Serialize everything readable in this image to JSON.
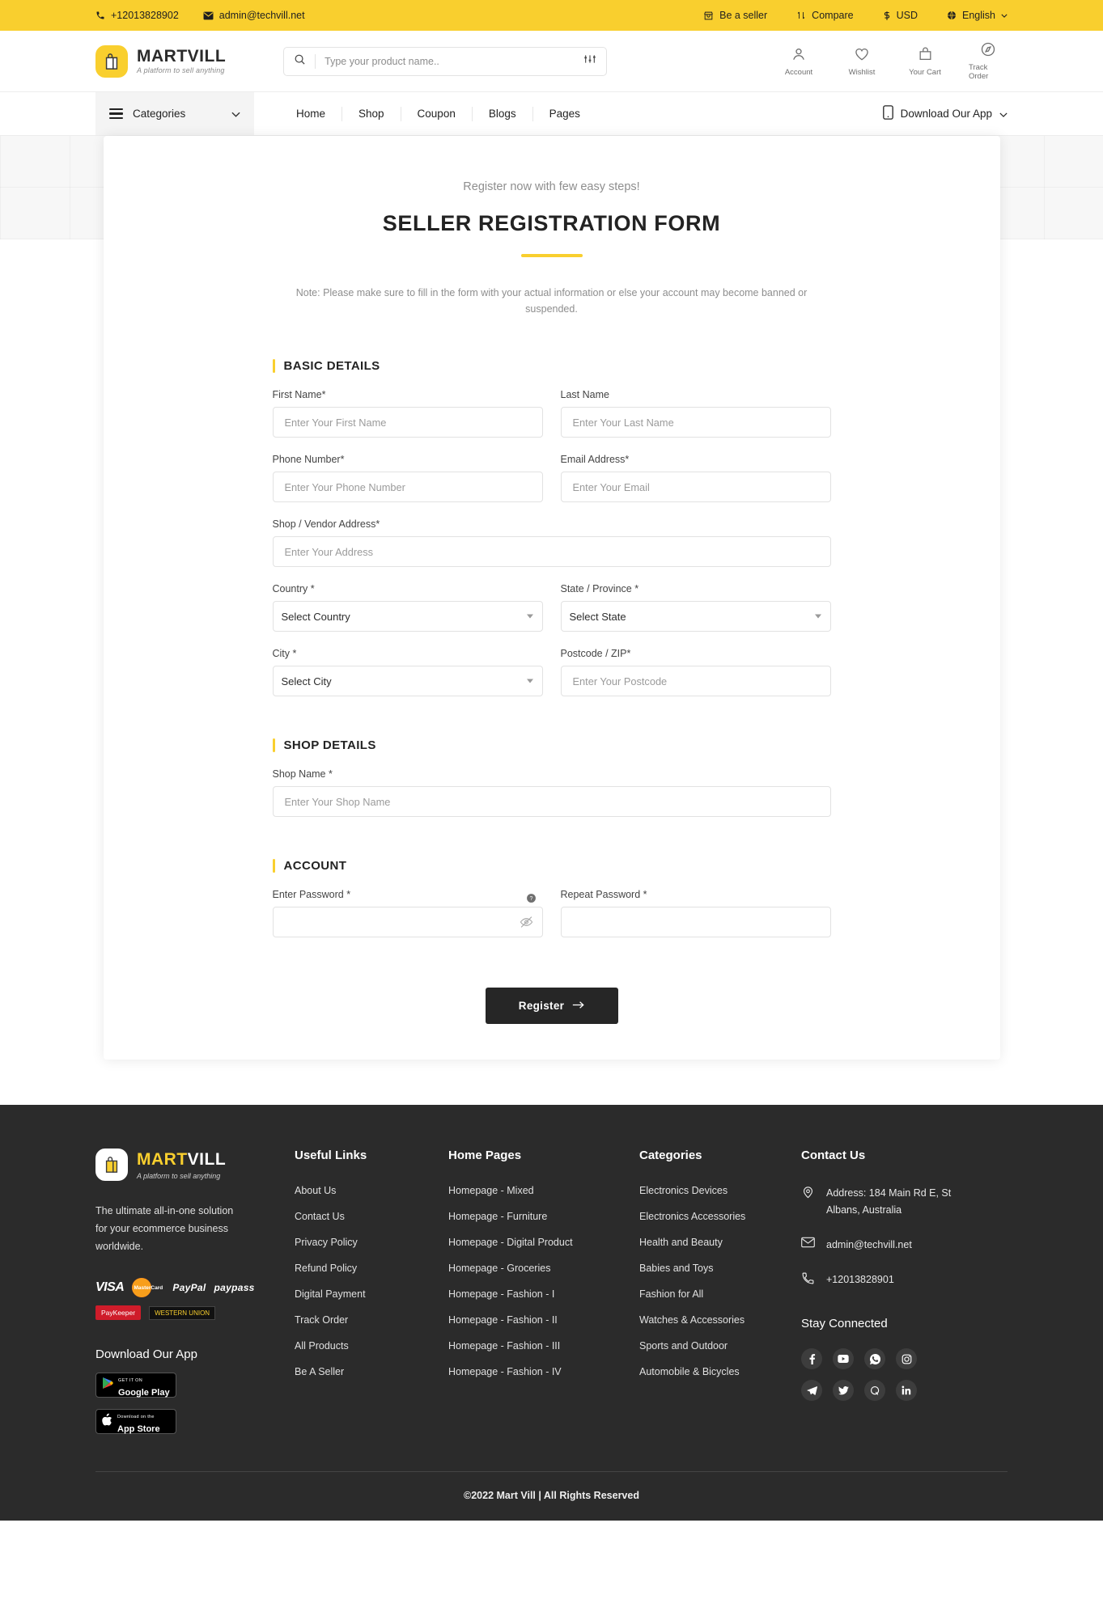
{
  "topbar": {
    "phone": "+12013828902",
    "email": "admin@techvill.net",
    "be_a_seller": "Be a seller",
    "compare": "Compare",
    "currency": "USD",
    "language": "English"
  },
  "brand": {
    "name_mart": "MART",
    "name_vill": "VILL",
    "name_full": "MARTVILL",
    "tagline": "A platform to sell anything"
  },
  "search": {
    "placeholder": "Type your product name.."
  },
  "header_actions": [
    {
      "label": "Account"
    },
    {
      "label": "Wishlist"
    },
    {
      "label": "Your Cart"
    },
    {
      "label": "Track Order"
    }
  ],
  "nav": {
    "categories": "Categories",
    "items": [
      {
        "label": "Home"
      },
      {
        "label": "Shop"
      },
      {
        "label": "Coupon"
      },
      {
        "label": "Blogs"
      },
      {
        "label": "Pages"
      }
    ],
    "download_app": "Download Our App"
  },
  "form": {
    "kicker": "Register now with few easy steps!",
    "title": "SELLER REGISTRATION FORM",
    "note": "Note: Please make sure to fill in the form with your actual information or else your account may become banned or suspended.",
    "section_basic": "BASIC DETAILS",
    "section_shop": "SHOP DETAILS",
    "section_account": "ACCOUNT",
    "first_name": {
      "label": "First Name*",
      "placeholder": "Enter Your First Name",
      "value": ""
    },
    "last_name": {
      "label": "Last Name",
      "placeholder": "Enter Your Last Name",
      "value": ""
    },
    "phone": {
      "label": "Phone Number*",
      "placeholder": "Enter Your Phone Number",
      "value": ""
    },
    "email": {
      "label": "Email Address*",
      "placeholder": "Enter Your Email",
      "value": ""
    },
    "address": {
      "label": "Shop / Vendor Address*",
      "placeholder": "Enter Your Address",
      "value": ""
    },
    "country": {
      "label": "Country *",
      "selected": "Select Country"
    },
    "state": {
      "label": "State / Province *",
      "selected": "Select State"
    },
    "city": {
      "label": "City *",
      "selected": "Select City"
    },
    "postcode": {
      "label": "Postcode / ZIP*",
      "placeholder": "Enter Your Postcode",
      "value": ""
    },
    "shop_name": {
      "label": "Shop Name *",
      "placeholder": "Enter Your Shop Name",
      "value": ""
    },
    "password": {
      "label": "Enter Password *",
      "placeholder": "",
      "value": ""
    },
    "repeat_password": {
      "label": "Repeat Password *",
      "placeholder": "",
      "value": ""
    },
    "submit": "Register"
  },
  "footer": {
    "description": "The ultimate all-in-one solution for your ecommerce business worldwide.",
    "payments": [
      {
        "name": "VISA"
      },
      {
        "name": "MasterCard"
      },
      {
        "name": "PayPal"
      },
      {
        "name": "paypass"
      },
      {
        "name": "PayKeeper"
      },
      {
        "name": "WESTERN UNION"
      }
    ],
    "download_title": "Download Our App",
    "google_play": {
      "small": "GET IT ON",
      "big": "Google Play"
    },
    "app_store": {
      "small": "Download on the",
      "big": "App Store"
    },
    "useful_links": {
      "title": "Useful Links",
      "items": [
        {
          "label": "About Us"
        },
        {
          "label": "Contact Us"
        },
        {
          "label": "Privacy Policy"
        },
        {
          "label": "Refund Policy"
        },
        {
          "label": "Digital Payment"
        },
        {
          "label": "Track Order"
        },
        {
          "label": "All Products"
        },
        {
          "label": "Be A Seller"
        }
      ]
    },
    "home_pages": {
      "title": "Home Pages",
      "items": [
        {
          "label": "Homepage - Mixed"
        },
        {
          "label": "Homepage - Furniture"
        },
        {
          "label": "Homepage - Digital Product"
        },
        {
          "label": "Homepage - Groceries"
        },
        {
          "label": "Homepage - Fashion - I"
        },
        {
          "label": "Homepage - Fashion - II"
        },
        {
          "label": "Homepage - Fashion - III"
        },
        {
          "label": "Homepage - Fashion - IV"
        }
      ]
    },
    "categories": {
      "title": "Categories",
      "items": [
        {
          "label": "Electronics Devices"
        },
        {
          "label": "Electronics Accessories"
        },
        {
          "label": "Health and Beauty"
        },
        {
          "label": "Babies and Toys"
        },
        {
          "label": "Fashion for All"
        },
        {
          "label": "Watches & Accessories"
        },
        {
          "label": "Sports and Outdoor"
        },
        {
          "label": "Automobile & Bicycles"
        }
      ]
    },
    "contact": {
      "title": "Contact Us",
      "address": "Address: 184 Main Rd E, St Albans, Australia",
      "email": "admin@techvill.net",
      "phone": "+12013828901",
      "stay_connected": "Stay Connected",
      "socials": [
        {
          "name": "facebook"
        },
        {
          "name": "youtube"
        },
        {
          "name": "whatsapp"
        },
        {
          "name": "instagram"
        },
        {
          "name": "telegram"
        },
        {
          "name": "twitter"
        },
        {
          "name": "quora"
        },
        {
          "name": "linkedin"
        }
      ]
    },
    "copyright": "©2022 Mart Vill | All Rights Reserved"
  },
  "colors": {
    "accent": "#f9cf2e",
    "dark": "#2b2b2b",
    "button": "#262626"
  }
}
